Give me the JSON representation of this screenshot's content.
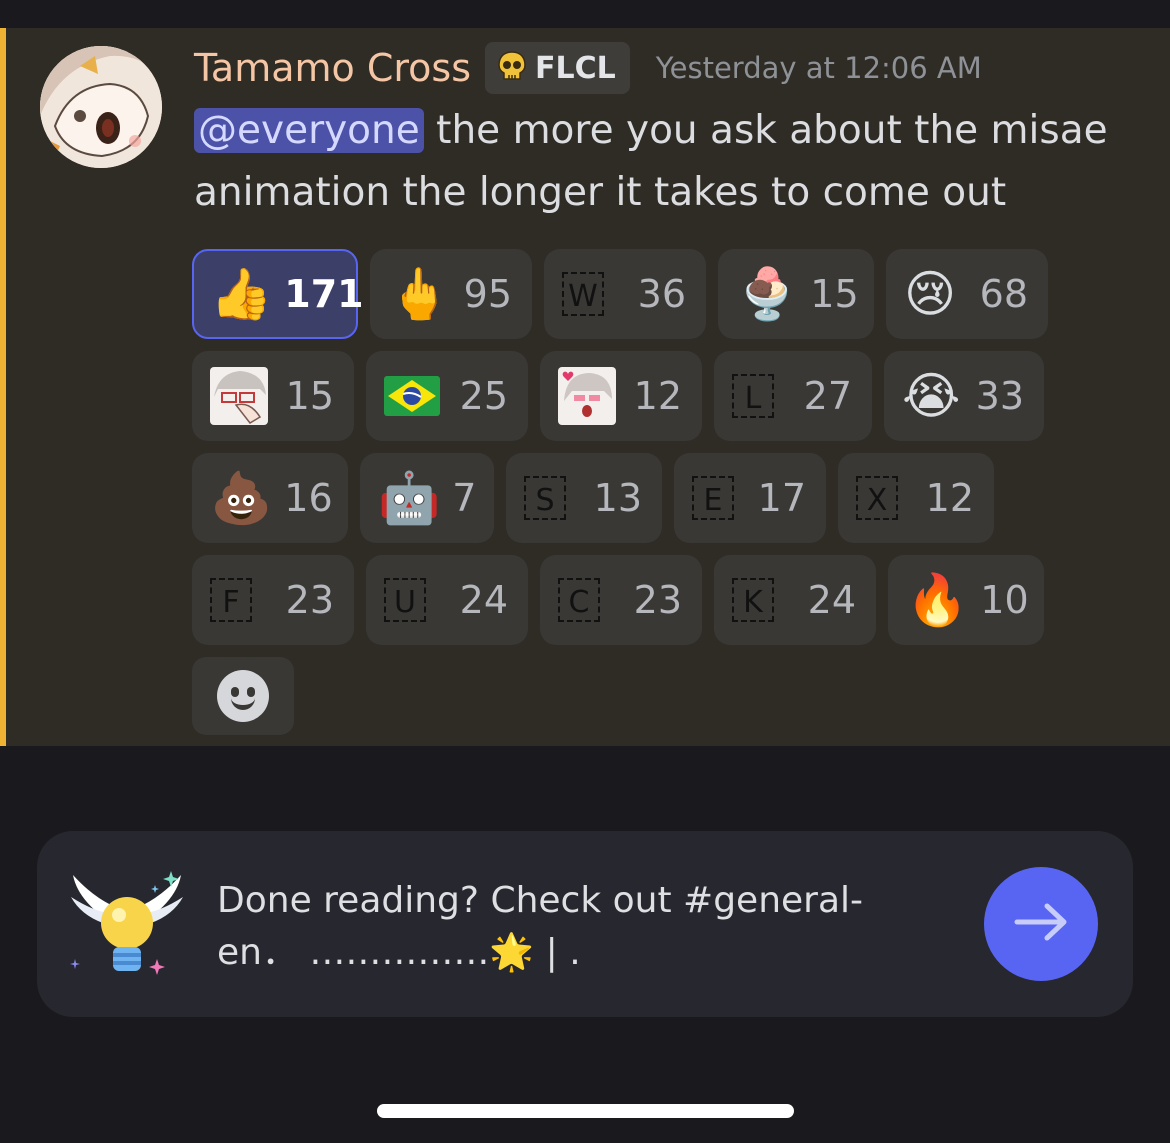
{
  "message": {
    "username": "Tamamo Cross",
    "role_tag": "FLCL",
    "timestamp": "Yesterday at 12:06 AM",
    "mention": "@everyone",
    "text": " the more you ask about the misae animation the longer it takes to come out"
  },
  "reactions": [
    [
      {
        "emoji": "👍",
        "count": "171",
        "me": true
      },
      {
        "emoji": "🖕",
        "count": "95"
      },
      {
        "glyph": "W",
        "count": "36"
      },
      {
        "emoji": "🍨",
        "count": "15"
      },
      {
        "emoji": "😢",
        "count": "68"
      }
    ],
    [
      {
        "custom": "anime-facepalm",
        "count": "15"
      },
      {
        "emoji": "🇧🇷",
        "count": "25"
      },
      {
        "custom": "anime-blush",
        "count": "12"
      },
      {
        "glyph": "L",
        "count": "27"
      },
      {
        "emoji": "😭",
        "count": "33"
      }
    ],
    [
      {
        "emoji": "💩",
        "count": "16"
      },
      {
        "emoji": "🤖",
        "count": "7"
      },
      {
        "glyph": "S",
        "count": "13"
      },
      {
        "glyph": "E",
        "count": "17"
      },
      {
        "glyph": "X",
        "count": "12"
      }
    ],
    [
      {
        "glyph": "F",
        "count": "23"
      },
      {
        "glyph": "U",
        "count": "24"
      },
      {
        "glyph": "C",
        "count": "23"
      },
      {
        "glyph": "K",
        "count": "24"
      },
      {
        "emoji": "🔥",
        "count": "10"
      }
    ]
  ],
  "add_reaction_icon": "smiley-icon",
  "banner": {
    "text_line1": "Done reading? Check out #general-",
    "text_line2": "en．  ……………🌟 | .",
    "icon": "winged-lightbulb-icon",
    "button_icon": "arrow-right-icon"
  },
  "colors": {
    "accent": "#5865f2",
    "message_highlight_border": "#f0b232",
    "username": "#f4c6a5"
  }
}
